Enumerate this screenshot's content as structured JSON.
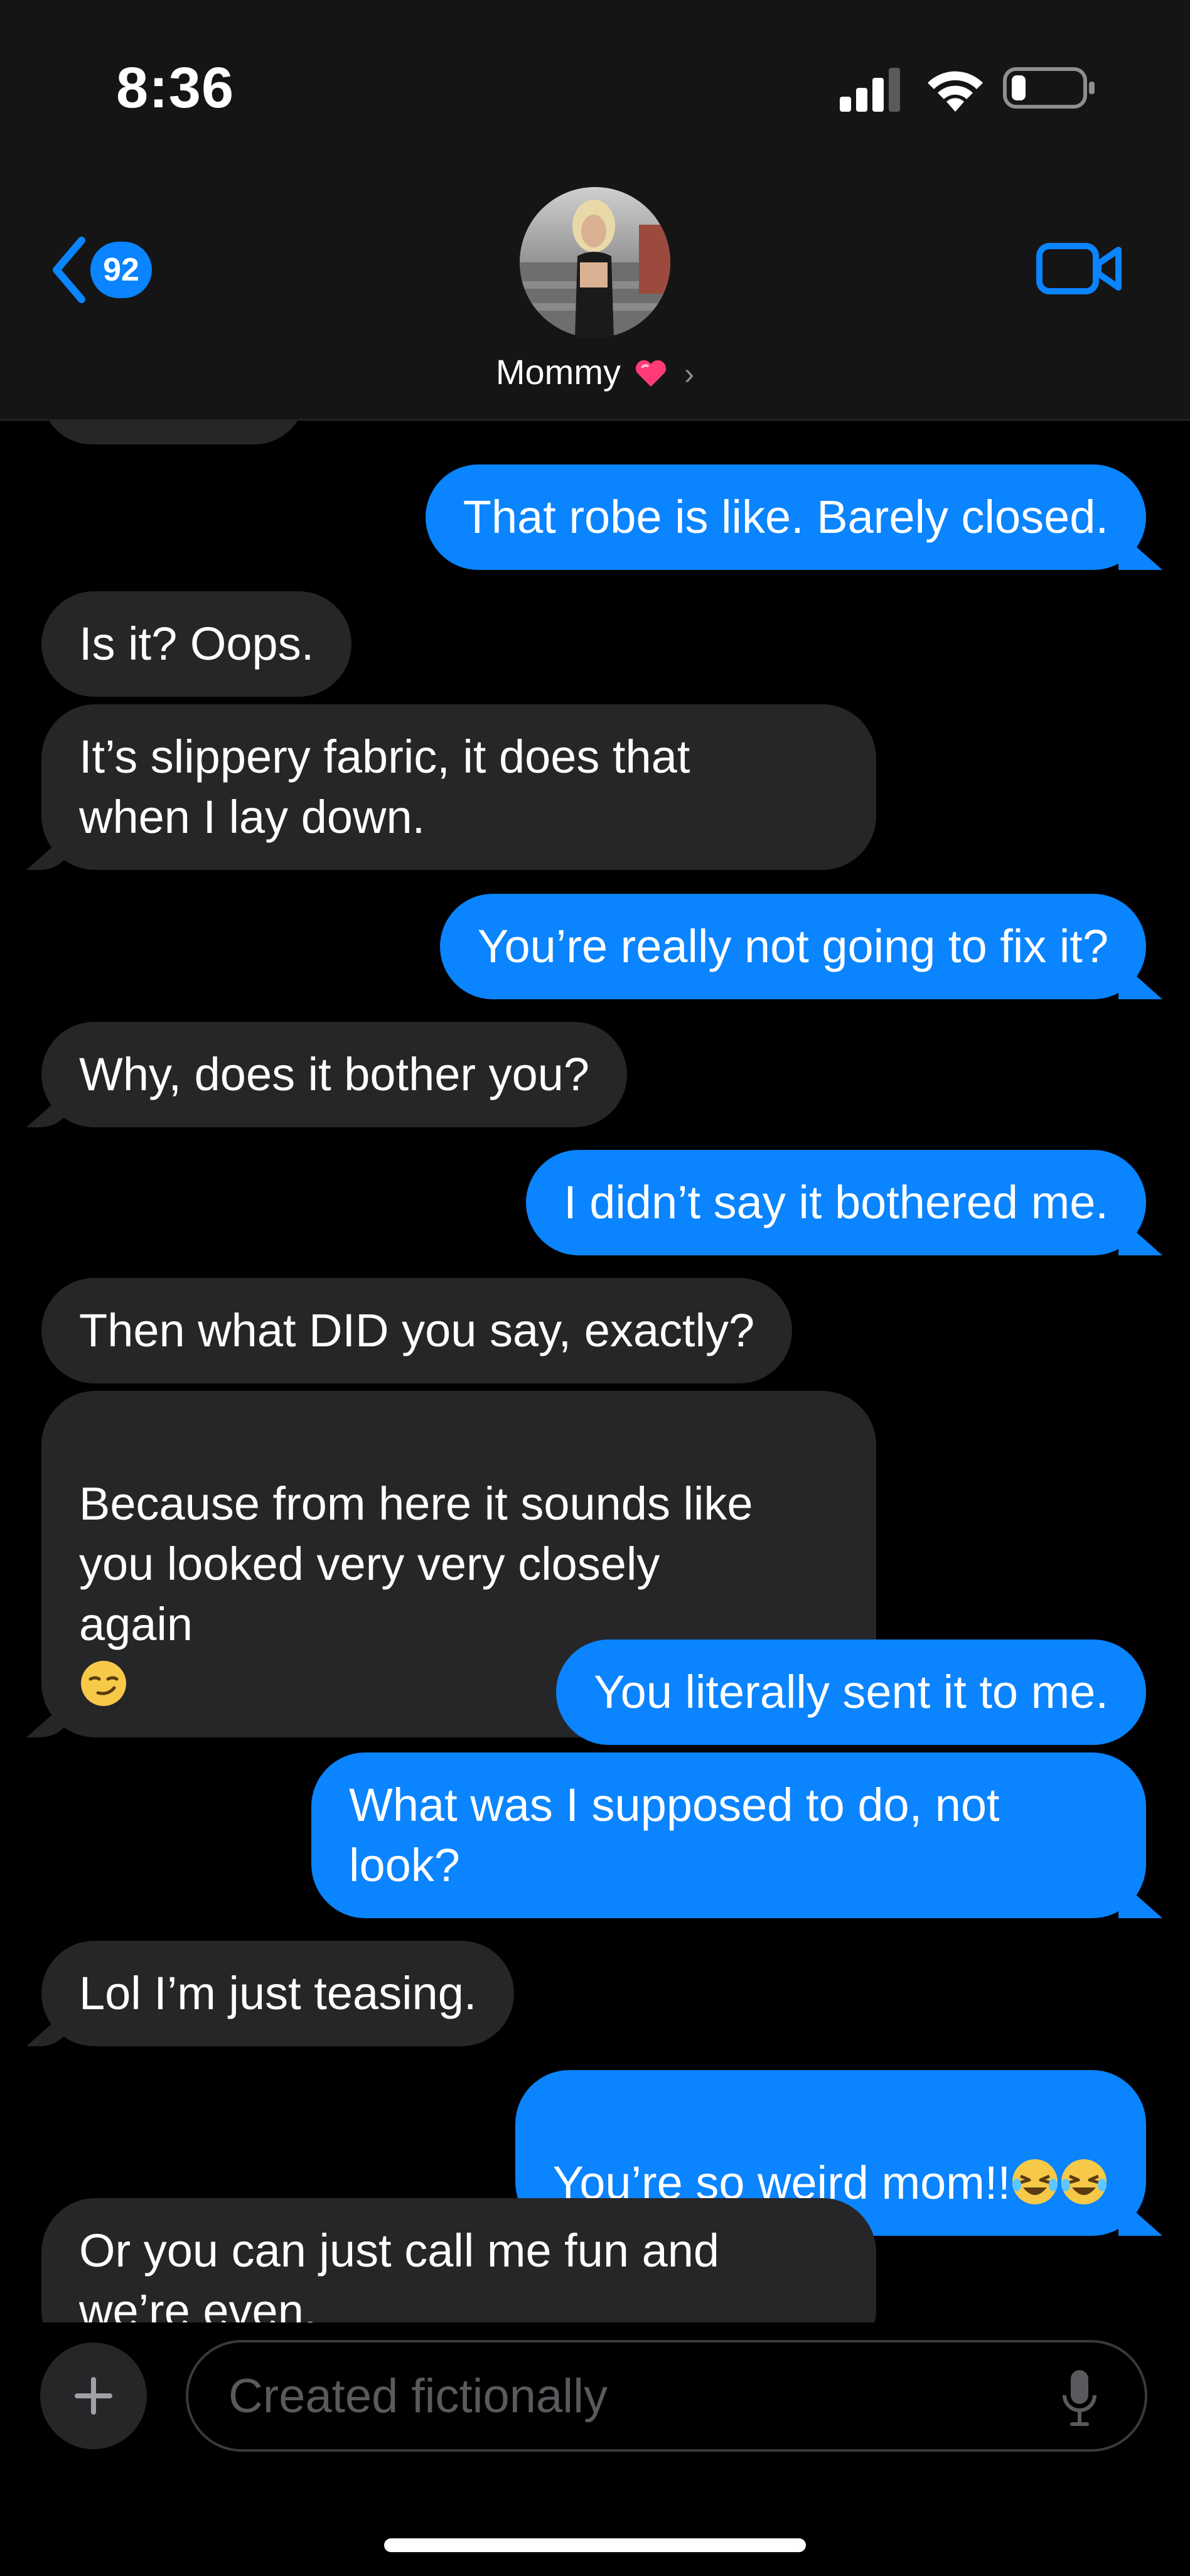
{
  "status_bar": {
    "time": "8:36",
    "icons": [
      "cellular-signal-icon",
      "wifi-icon",
      "battery-icon"
    ],
    "battery_level": 0.15
  },
  "header": {
    "back_badge": "92",
    "contact_name": "Mommy",
    "name_emoji": "heart-emoji",
    "icons": [
      "back-chevron-icon",
      "video-call-icon",
      "disclosure-chevron-icon"
    ]
  },
  "messages": [
    {
      "side": "out",
      "text": "That robe is like. Barely closed."
    },
    {
      "side": "in",
      "text": "Is it? Oops."
    },
    {
      "side": "in",
      "text": "It’s slippery fabric, it does that\nwhen I lay down."
    },
    {
      "side": "out",
      "text": "You’re really not going to fix it?"
    },
    {
      "side": "in",
      "text": "Why, does it bother you?"
    },
    {
      "side": "out",
      "text": "I didn’t say it bothered me."
    },
    {
      "side": "in",
      "text": "Then what DID you say, exactly?"
    },
    {
      "side": "in",
      "text": "Because from here it sounds like\nyou looked very very closely\nagain",
      "emoji": "smirk-emoji"
    },
    {
      "side": "out",
      "text": "You literally sent it to me."
    },
    {
      "side": "out",
      "text": "What was I supposed to do, not\nlook?"
    },
    {
      "side": "in",
      "text": "Lol I’m just teasing."
    },
    {
      "side": "out",
      "text": "You’re so weird mom!!",
      "emoji": "tears-of-joy-emoji x2"
    },
    {
      "side": "in",
      "text": "Or you can just call me fun and\nwe’re even."
    }
  ],
  "composer": {
    "placeholder": "Created fictionally",
    "icons": [
      "plus-icon",
      "microphone-icon"
    ]
  },
  "colors": {
    "outgoing_bubble": "#0a84ff",
    "incoming_bubble": "#262628",
    "background": "#000000",
    "header": "#151515"
  }
}
